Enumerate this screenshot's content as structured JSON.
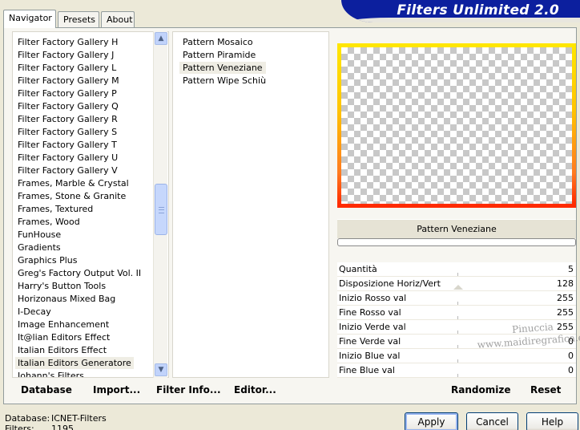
{
  "app": {
    "title": "Filters Unlimited 2.0"
  },
  "tabs": [
    {
      "label": "Navigator",
      "active": true
    },
    {
      "label": "Presets",
      "active": false
    },
    {
      "label": "About",
      "active": false
    }
  ],
  "categories": {
    "items": [
      "Filter Factory Gallery H",
      "Filter Factory Gallery J",
      "Filter Factory Gallery L",
      "Filter Factory Gallery M",
      "Filter Factory Gallery P",
      "Filter Factory Gallery Q",
      "Filter Factory Gallery R",
      "Filter Factory Gallery S",
      "Filter Factory Gallery T",
      "Filter Factory Gallery U",
      "Filter Factory Gallery V",
      "Frames, Marble & Crystal",
      "Frames, Stone & Granite",
      "Frames, Textured",
      "Frames, Wood",
      "FunHouse",
      "Gradients",
      "Graphics Plus",
      "Greg's Factory Output Vol. II",
      "Harry's Button Tools",
      "Horizonaus Mixed Bag",
      "I-Decay",
      "Image Enhancement",
      "It@lian Editors Effect",
      "Italian Editors Effect",
      "Italian Editors Generatore",
      "Johann's Filters"
    ],
    "selected_index": 25
  },
  "filters": {
    "items": [
      "Pattern Mosaico",
      "Pattern Piramide",
      "Pattern Veneziane",
      "Pattern Wipe Schiù"
    ],
    "selected_index": 2
  },
  "preview": {
    "filter_name": "Pattern Veneziane"
  },
  "params": [
    {
      "label": "Quantità",
      "value": "5"
    },
    {
      "label": "Disposizione Horiz/Vert",
      "value": "128"
    },
    {
      "label": "Inizio Rosso val",
      "value": "255"
    },
    {
      "label": "Fine Rosso val",
      "value": "255"
    },
    {
      "label": "Inizio Verde val",
      "value": "255"
    },
    {
      "label": "Fine Verde val",
      "value": "0"
    },
    {
      "label": "Inizio Blue val",
      "value": "0"
    },
    {
      "label": "Fine Blue val",
      "value": "0"
    }
  ],
  "watermark": {
    "line1": "Pinuccia",
    "line2": "www.maidiregrafica.eu"
  },
  "toolbar": {
    "database_label": "Database",
    "import_label": "Import...",
    "filter_info_label": "Filter Info...",
    "editor_label": "Editor...",
    "randomize_label": "Randomize",
    "reset_label": "Reset"
  },
  "status": {
    "database_label": "Database:",
    "database_value": "ICNET-Filters",
    "filters_label": "Filters:",
    "filters_value": "1195"
  },
  "buttons": {
    "apply": "Apply",
    "cancel": "Cancel",
    "help": "Help"
  },
  "icons": {
    "scroll_up": "chevron-up-icon",
    "scroll_down": "chevron-down-icon"
  },
  "colors": {
    "logo_bg": "#0c1f9e",
    "frame_top": "#ffe600",
    "frame_bottom": "#ff2a00",
    "accent_blue": "#c1d3fb"
  }
}
